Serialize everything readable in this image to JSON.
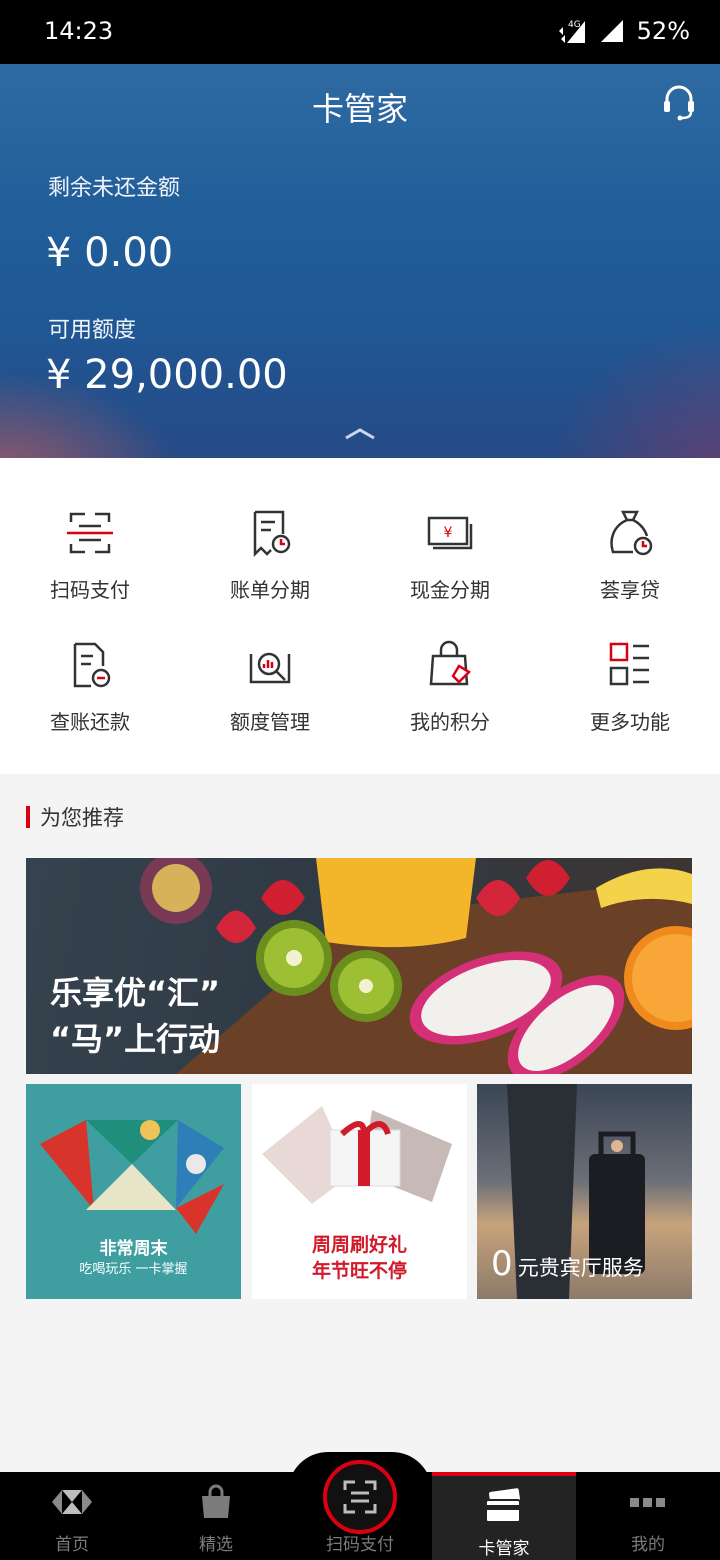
{
  "status_bar": {
    "time": "14:23",
    "network": "4G",
    "battery": "52%"
  },
  "header": {
    "title": "卡管家"
  },
  "account": {
    "outstanding_label": "剩余未还金额",
    "outstanding_amount": "¥ 0.00",
    "credit_label": "可用额度",
    "credit_amount": "¥ 29,000.00"
  },
  "functions": [
    {
      "label": "扫码支付",
      "icon": "scan-pay-icon"
    },
    {
      "label": "账单分期",
      "icon": "bill-installment-icon"
    },
    {
      "label": "现金分期",
      "icon": "cash-installment-icon"
    },
    {
      "label": "荟享贷",
      "icon": "loan-bag-icon"
    },
    {
      "label": "查账还款",
      "icon": "statement-repay-icon"
    },
    {
      "label": "额度管理",
      "icon": "credit-limit-icon"
    },
    {
      "label": "我的积分",
      "icon": "points-bag-icon"
    },
    {
      "label": "更多功能",
      "icon": "more-functions-icon"
    }
  ],
  "recommend": {
    "title": "为您推荐",
    "banner": {
      "line1": "乐享优“汇”",
      "line2": "“马”上行动"
    },
    "tiles": [
      {
        "line1": "非常周末",
        "line2": "吃喝玩乐 一卡掌握"
      },
      {
        "line1": "周周刷好礼",
        "line2": "年节旺不停"
      },
      {
        "number": "0",
        "text": "元贵宾厅服务"
      }
    ]
  },
  "tabbar": {
    "active_color": "#db0011",
    "items": [
      {
        "label": "首页",
        "icon": "hsbc-logo-icon"
      },
      {
        "label": "精选",
        "icon": "shopping-bag-icon"
      },
      {
        "label": "扫码支付",
        "icon": "scan-icon"
      },
      {
        "label": "卡管家",
        "icon": "card-icon"
      },
      {
        "label": "我的",
        "icon": "more-dots-icon"
      }
    ]
  }
}
